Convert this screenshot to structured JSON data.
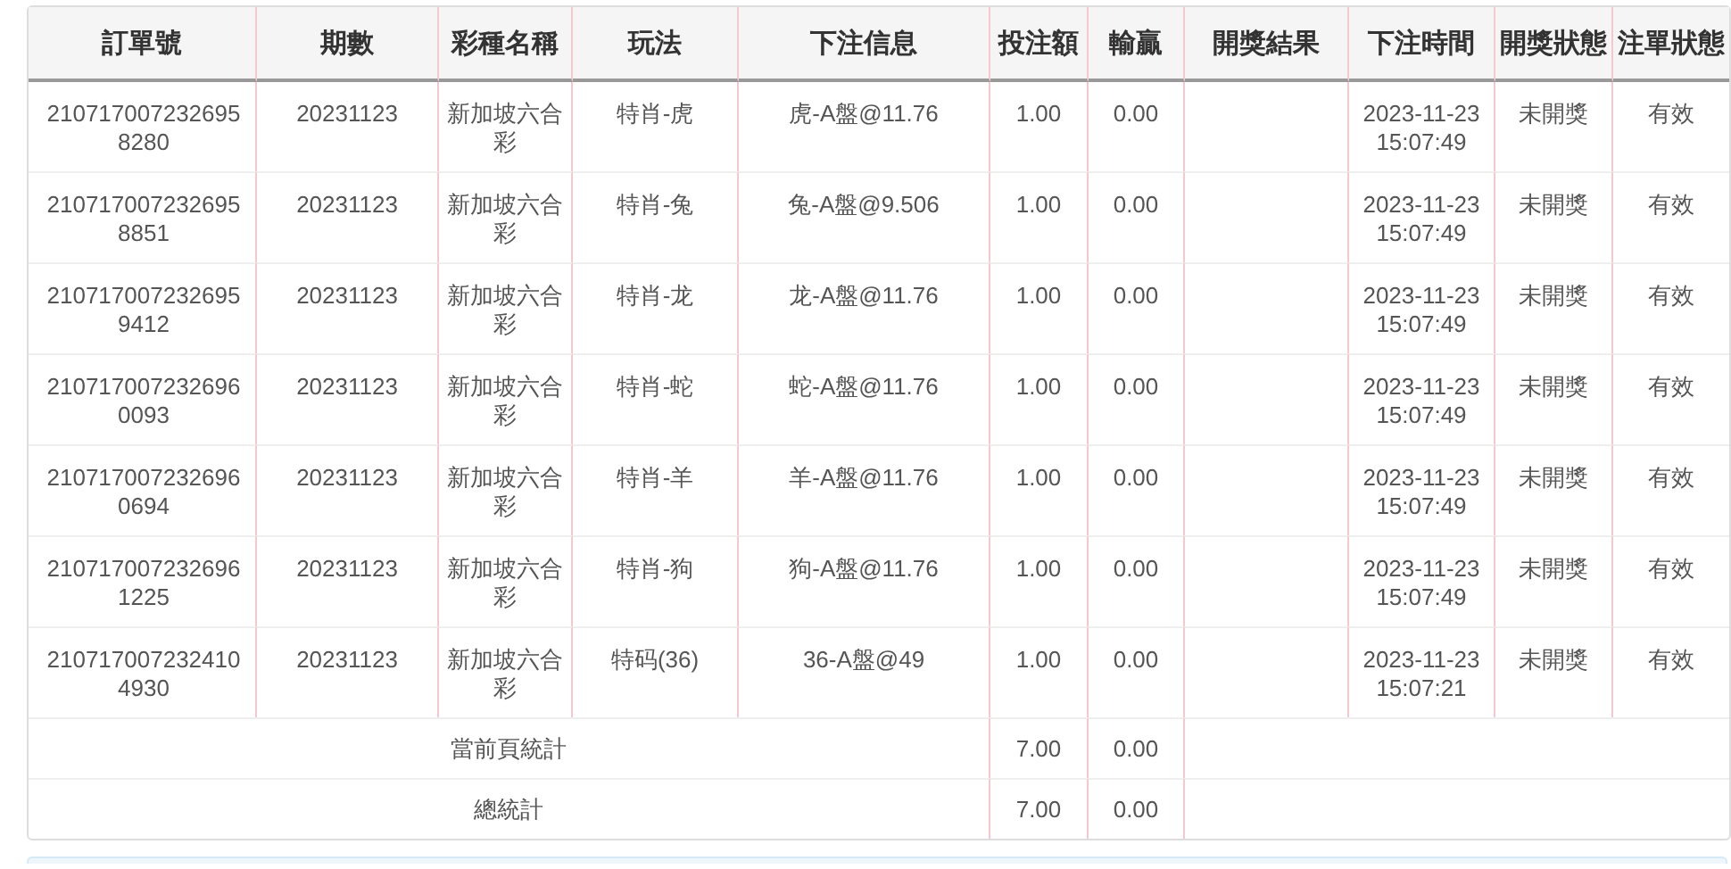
{
  "table": {
    "columns": [
      "訂單號",
      "期數",
      "彩種名稱",
      "玩法",
      "下注信息",
      "投注額",
      "輸贏",
      "開獎結果",
      "下注時間",
      "開獎狀態",
      "注單狀態"
    ],
    "rows": [
      {
        "order_no": "2107170072326958280",
        "period": "20231123",
        "lottery": "新加坡六合彩",
        "play": "特肖-虎",
        "bet_info": "虎-A盤@11.76",
        "amount": "1.00",
        "win_loss": "0.00",
        "bet_time": "2023-11-23 15:07:49",
        "draw_status": "未開獎",
        "bet_status": "有效"
      },
      {
        "order_no": "2107170072326958851",
        "period": "20231123",
        "lottery": "新加坡六合彩",
        "play": "特肖-兔",
        "bet_info": "兔-A盤@9.506",
        "amount": "1.00",
        "win_loss": "0.00",
        "bet_time": "2023-11-23 15:07:49",
        "draw_status": "未開獎",
        "bet_status": "有效"
      },
      {
        "order_no": "2107170072326959412",
        "period": "20231123",
        "lottery": "新加坡六合彩",
        "play": "特肖-龙",
        "bet_info": "龙-A盤@11.76",
        "amount": "1.00",
        "win_loss": "0.00",
        "bet_time": "2023-11-23 15:07:49",
        "draw_status": "未開獎",
        "bet_status": "有效"
      },
      {
        "order_no": "2107170072326960093",
        "period": "20231123",
        "lottery": "新加坡六合彩",
        "play": "特肖-蛇",
        "bet_info": "蛇-A盤@11.76",
        "amount": "1.00",
        "win_loss": "0.00",
        "bet_time": "2023-11-23 15:07:49",
        "draw_status": "未開獎",
        "bet_status": "有效"
      },
      {
        "order_no": "2107170072326960694",
        "period": "20231123",
        "lottery": "新加坡六合彩",
        "play": "特肖-羊",
        "bet_info": "羊-A盤@11.76",
        "amount": "1.00",
        "win_loss": "0.00",
        "bet_time": "2023-11-23 15:07:49",
        "draw_status": "未開獎",
        "bet_status": "有效"
      },
      {
        "order_no": "2107170072326961225",
        "period": "20231123",
        "lottery": "新加坡六合彩",
        "play": "特肖-狗",
        "bet_info": "狗-A盤@11.76",
        "amount": "1.00",
        "win_loss": "0.00",
        "bet_time": "2023-11-23 15:07:49",
        "draw_status": "未開獎",
        "bet_status": "有效"
      },
      {
        "order_no": "2107170072324104930",
        "period": "20231123",
        "lottery": "新加坡六合彩",
        "play": "特码(36)",
        "bet_info": "36-A盤@49",
        "amount": "1.00",
        "win_loss": "0.00",
        "bet_time": "2023-11-23 15:07:21",
        "draw_status": "未開獎",
        "bet_status": "有效"
      }
    ],
    "summary": [
      {
        "label": "當前頁統計",
        "amount": "7.00",
        "win_loss": "0.00"
      },
      {
        "label": "總統計",
        "amount": "7.00",
        "win_loss": "0.00"
      }
    ]
  }
}
